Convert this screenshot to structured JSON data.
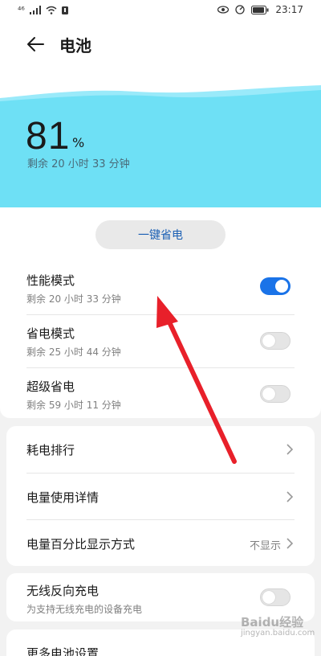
{
  "status_bar": {
    "signal_text": "⁴⁶",
    "time": "23:17"
  },
  "header": {
    "title": "电池"
  },
  "battery": {
    "level": "81",
    "unit": "%",
    "remaining": "剩余 20 小时 33 分钟",
    "wave_color": "#6ee0f5"
  },
  "actions": {
    "one_key_save": "一键省电"
  },
  "modes": [
    {
      "title": "性能模式",
      "sub": "剩余 20 小时 33 分钟",
      "enabled": true
    },
    {
      "title": "省电模式",
      "sub": "剩余 25 小时 44 分钟",
      "enabled": false
    },
    {
      "title": "超级省电",
      "sub": "剩余 59 小时 11 分钟",
      "enabled": false
    }
  ],
  "links": [
    {
      "title": "耗电排行"
    },
    {
      "title": "电量使用详情"
    },
    {
      "title": "电量百分比显示方式",
      "value": "不显示"
    }
  ],
  "wireless": {
    "title": "无线反向充电",
    "sub": "为支持无线充电的设备充电",
    "enabled": false
  },
  "more": {
    "title": "更多电池设置"
  },
  "watermark": {
    "brand": "Baidu经验",
    "url": "jingyan.baidu.com"
  },
  "colors": {
    "accent": "#1a73e8",
    "arrow": "#e8202a"
  }
}
